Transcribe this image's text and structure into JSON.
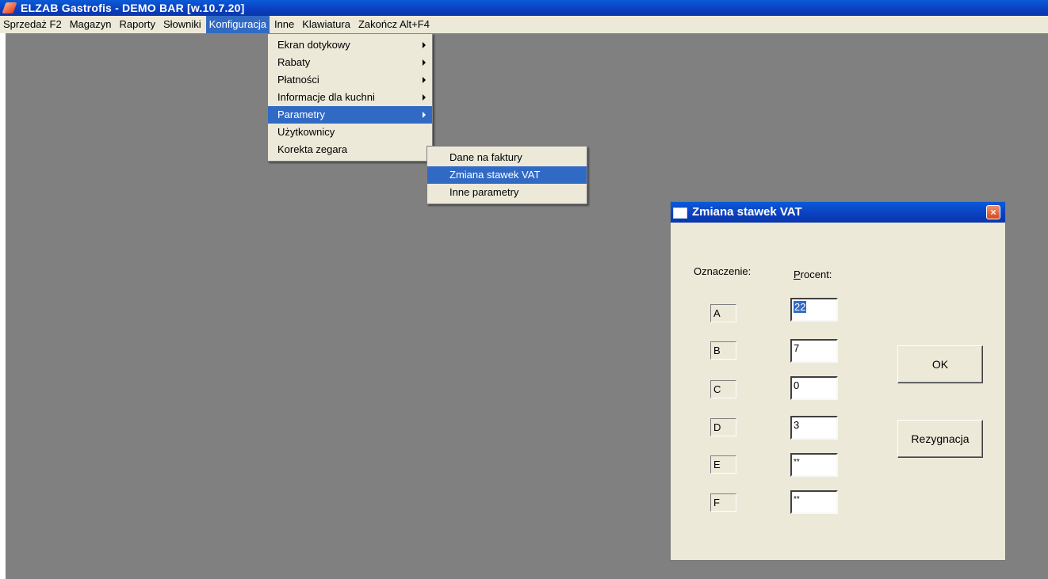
{
  "window": {
    "title": "ELZAB Gastrofis - DEMO BAR [w.10.7.20]"
  },
  "menubar": {
    "items": [
      "Sprzedaż F2",
      "Magazyn",
      "Raporty",
      "Słowniki",
      "Konfiguracja",
      "Inne",
      "Klawiatura",
      "Zakończ Alt+F4"
    ]
  },
  "konfiguracja_menu": {
    "items": [
      "Ekran dotykowy",
      "Rabaty",
      "Płatności",
      "Informacje dla kuchni",
      "Parametry",
      "Użytkownicy",
      "Korekta zegara"
    ]
  },
  "parametry_menu": {
    "items": [
      "Dane na faktury",
      "Zmiana stawek VAT",
      "Inne parametry"
    ]
  },
  "dialog": {
    "title": "Zmiana stawek VAT",
    "label_code": "Oznaczenie:",
    "label_percent_accel": "P",
    "label_percent_rest": "rocent:",
    "rows": [
      {
        "code": "A",
        "percent": "22"
      },
      {
        "code": "B",
        "percent": "7"
      },
      {
        "code": "C",
        "percent": "0"
      },
      {
        "code": "D",
        "percent": "3"
      },
      {
        "code": "E",
        "percent": "**"
      },
      {
        "code": "F",
        "percent": "**"
      }
    ],
    "ok_label": "OK",
    "cancel_label": "Rezygnacja"
  }
}
